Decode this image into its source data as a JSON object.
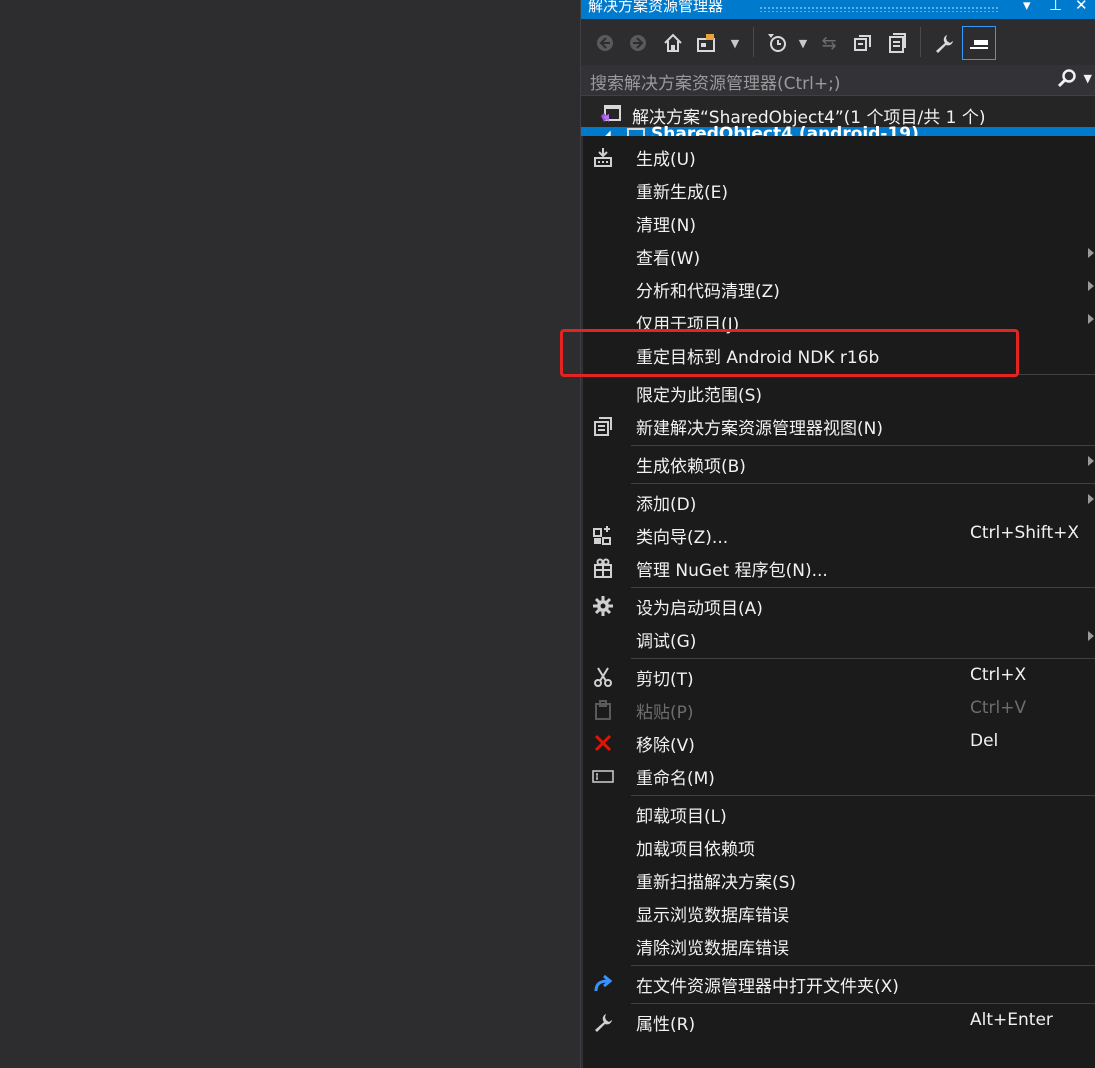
{
  "window": {
    "title": "解决方案资源管理器",
    "title_buttons": [
      "▾",
      "⊥",
      "✕"
    ]
  },
  "toolbar": {
    "buttons": [
      {
        "name": "back-icon",
        "glyph": "◀"
      },
      {
        "name": "forward-icon",
        "glyph": "▶"
      },
      {
        "name": "home-icon",
        "glyph": "⌂"
      },
      {
        "name": "switch-views-icon",
        "glyph": "▦"
      },
      {
        "name": "pending-changes-icon",
        "glyph": "◷"
      },
      {
        "name": "sync-icon",
        "glyph": "⇆"
      },
      {
        "name": "collapse-all-icon",
        "glyph": "⧉"
      },
      {
        "name": "show-all-files-icon",
        "glyph": "▤"
      },
      {
        "name": "properties-wrench-icon",
        "glyph": "🔧"
      },
      {
        "name": "preview-icon",
        "glyph": "▬"
      }
    ]
  },
  "search": {
    "placeholder": "搜索解决方案资源管理器(Ctrl+;)"
  },
  "tree": {
    "solution_label": "解决方案“SharedObject4”(1 个项目/共 1 个)",
    "project_label": "SharedObject4 (android-19)"
  },
  "menu": {
    "items": [
      {
        "label": "生成(U)",
        "icon": "build-icon"
      },
      {
        "label": "重新生成(E)"
      },
      {
        "label": "清理(N)"
      },
      {
        "label": "查看(W)",
        "submenu": true
      },
      {
        "label": "分析和代码清理(Z)",
        "submenu": true
      },
      {
        "label": "仅用于项目(J)",
        "submenu": true
      },
      {
        "label": "重定目标到 Android NDK r16b"
      },
      {
        "label": "限定为此范围(S)"
      },
      {
        "label": "新建解决方案资源管理器视图(N)",
        "icon": "new-view-icon"
      },
      {
        "label": "生成依赖项(B)",
        "submenu": true
      },
      {
        "label": "添加(D)",
        "submenu": true
      },
      {
        "label": "类向导(Z)...",
        "shortcut": "Ctrl+Shift+X",
        "icon": "class-wizard-icon"
      },
      {
        "label": "管理 NuGet 程序包(N)...",
        "icon": "nuget-icon"
      },
      {
        "label": "设为启动项目(A)",
        "icon": "gear-icon"
      },
      {
        "label": "调试(G)",
        "submenu": true
      },
      {
        "label": "剪切(T)",
        "shortcut": "Ctrl+X",
        "icon": "scissors-icon"
      },
      {
        "label": "粘贴(P)",
        "shortcut": "Ctrl+V",
        "icon": "paste-icon",
        "disabled": true
      },
      {
        "label": "移除(V)",
        "shortcut": "Del",
        "icon": "remove-icon"
      },
      {
        "label": "重命名(M)",
        "icon": "rename-icon"
      },
      {
        "label": "卸载项目(L)"
      },
      {
        "label": "加载项目依赖项"
      },
      {
        "label": "重新扫描解决方案(S)"
      },
      {
        "label": "显示浏览数据库错误"
      },
      {
        "label": "清除浏览数据库错误"
      },
      {
        "label": "在文件资源管理器中打开文件夹(X)",
        "icon": "open-folder-icon"
      },
      {
        "label": "属性(R)",
        "shortcut": "Alt+Enter",
        "icon": "wrench-icon"
      }
    ]
  },
  "colors": {
    "accent": "#007acc",
    "menu_bg": "#1b1b1c",
    "highlight_box": "#e52421",
    "remove_icon": "#e51400",
    "open_folder_icon": "#3794ff"
  }
}
